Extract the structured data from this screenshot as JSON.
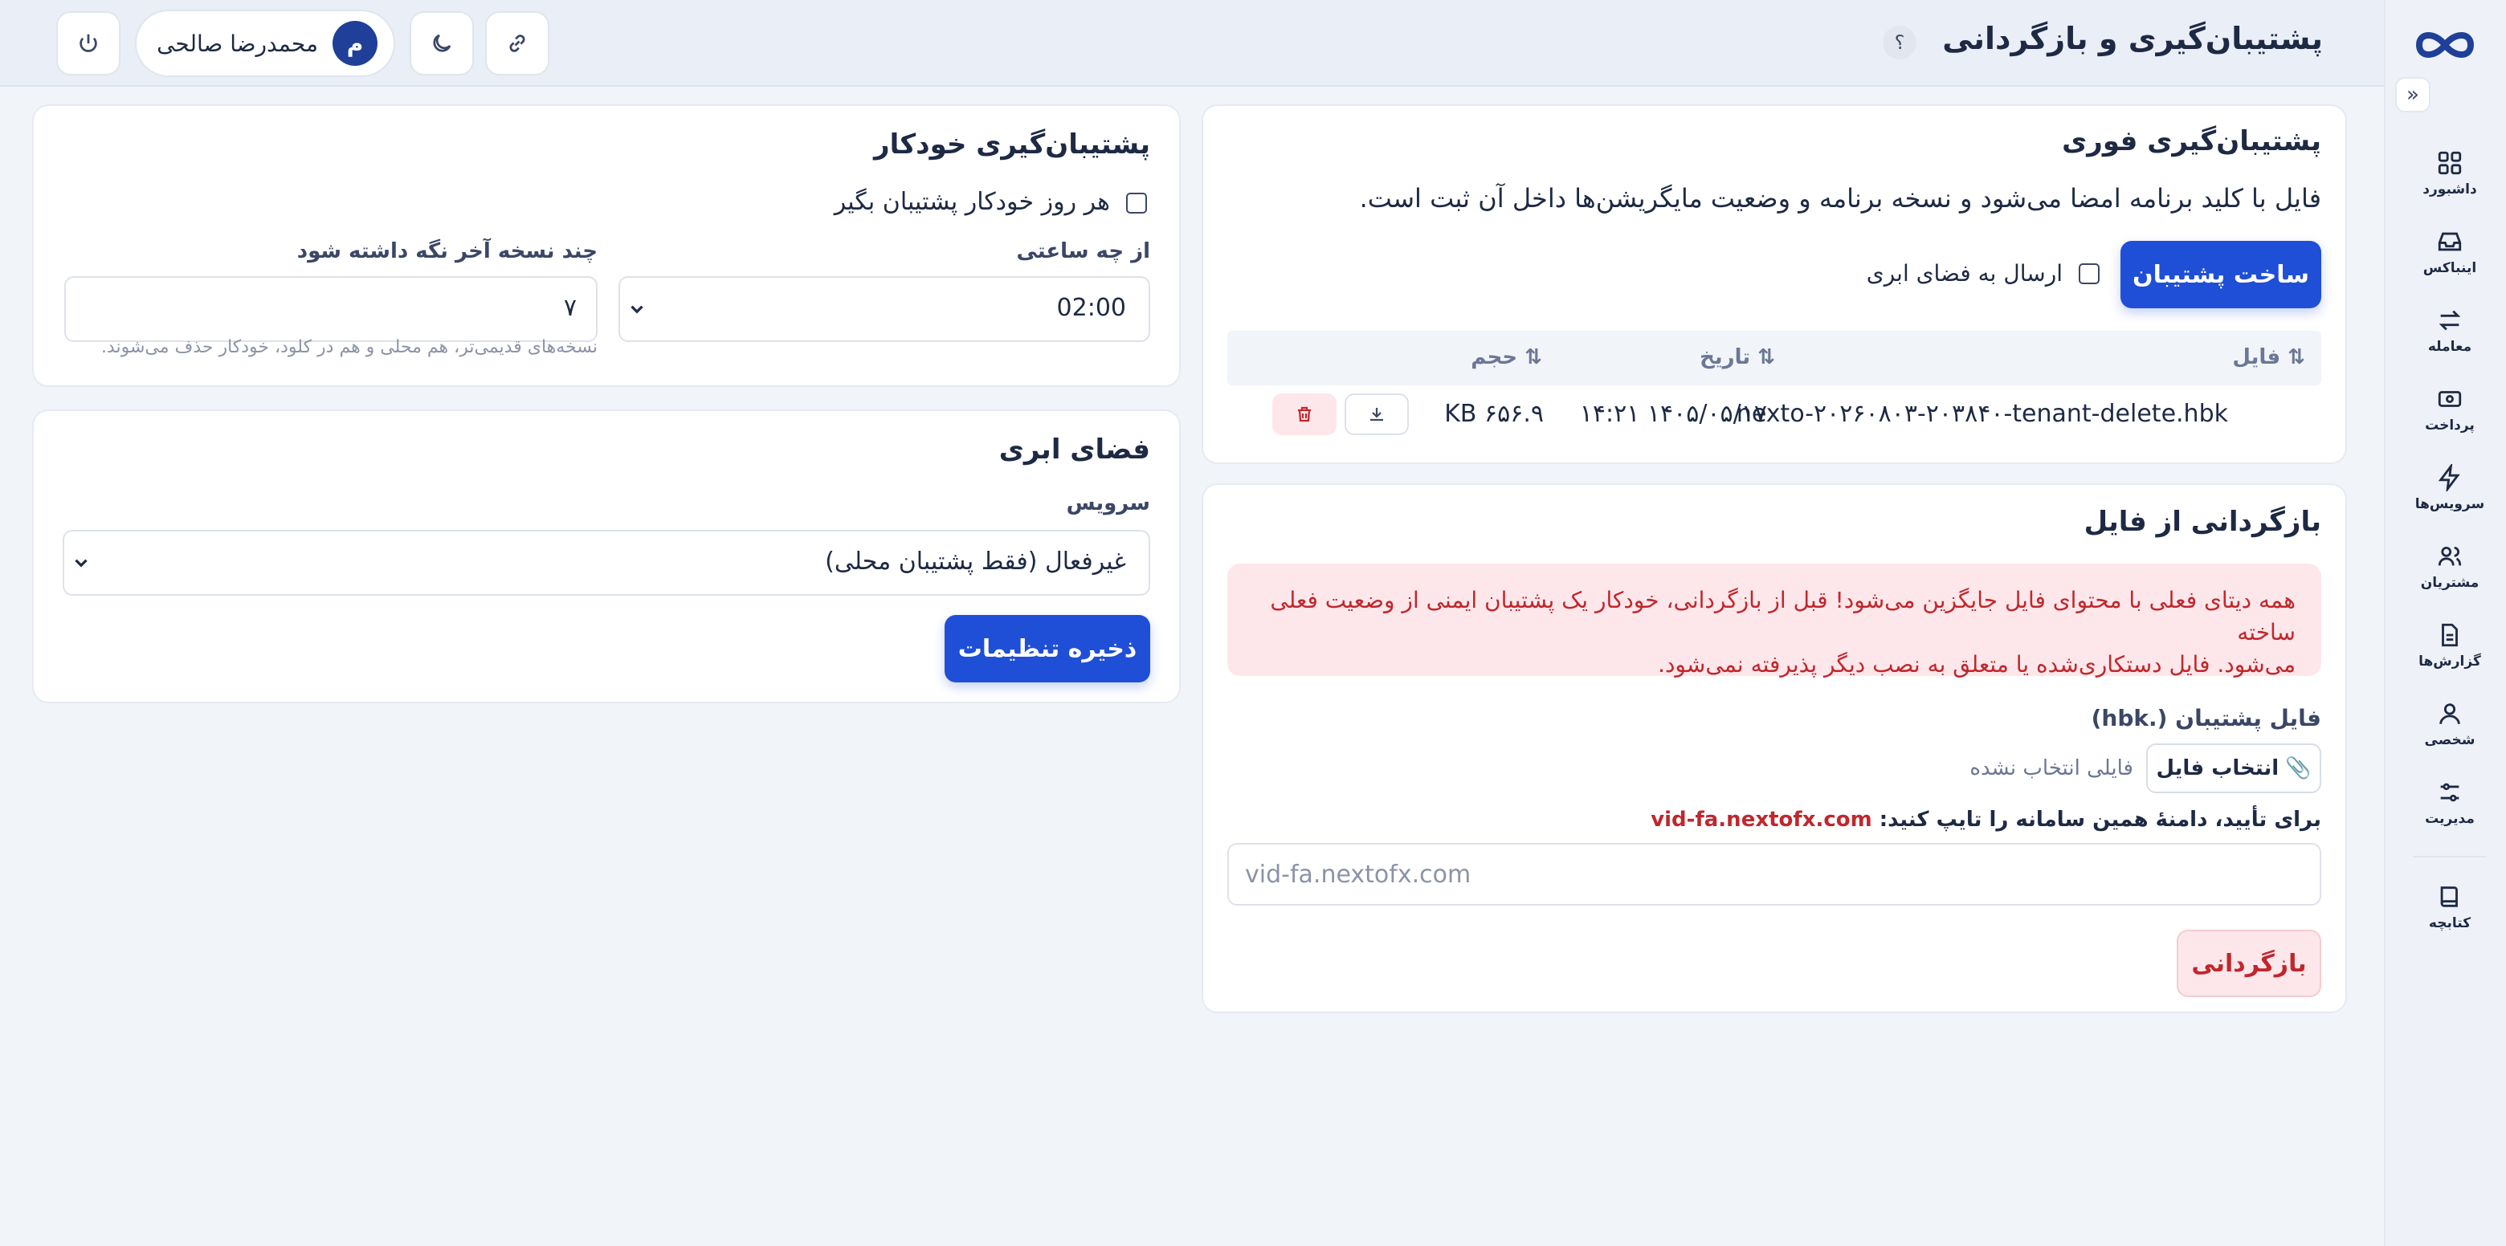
{
  "page": {
    "title": "پشتیبان‌گیری و بازگردانی",
    "help": "؟"
  },
  "sidebar": {
    "items": [
      {
        "label": "داشبورد",
        "icon": "dashboard-icon"
      },
      {
        "label": "اینباکس",
        "icon": "inbox-icon"
      },
      {
        "label": "معامله",
        "icon": "trade-icon"
      },
      {
        "label": "پرداخت",
        "icon": "payment-icon"
      },
      {
        "label": "سرویس‌ها",
        "icon": "lightning-icon"
      },
      {
        "label": "مشتریان",
        "icon": "users-icon"
      },
      {
        "label": "گزارش‌ها",
        "icon": "report-icon"
      },
      {
        "label": "شخصی",
        "icon": "user-icon"
      },
      {
        "label": "مدیریت",
        "icon": "sliders-icon"
      }
    ],
    "footer_item": {
      "label": "کتابچه",
      "icon": "book-icon"
    }
  },
  "header": {
    "user_name": "محمدرضا صالحی",
    "user_initial": "م"
  },
  "instant_backup": {
    "title": "پشتیبان‌گیری فوری",
    "description": "فایل با کلید برنامه امضا می‌شود و نسخه برنامه و وضعیت مایگریشن‌ها داخل آن ثبت است.",
    "create_button": "ساخت پشتیبان",
    "cloud_checkbox_label": "ارسال به فضای ابری",
    "table": {
      "headers": {
        "file": "⇅ فایل",
        "date": "⇅ تاریخ",
        "size": "⇅ حجم"
      },
      "rows": [
        {
          "file": "nexto-۲۰۲۶۰۸۰۳-۲۰۳۸۴۰-tenant-delete.hbk",
          "date": "۱۴۰۵/۰۵/۱۷ ۱۴:۲۱",
          "size": "۶۵۶.۹ KB"
        }
      ]
    }
  },
  "restore": {
    "title": "بازگردانی از فایل",
    "warning_line1": "همه دیتای فعلی با محتوای فایل جایگزین می‌شود! قبل از بازگردانی، خودکار یک پشتیبان ایمنی از وضعیت فعلی ساخته",
    "warning_line2": "می‌شود. فایل دستکاری‌شده یا متعلق به نصب دیگر پذیرفته نمی‌شود.",
    "file_label": "فایل پشتیبان (.hbk)",
    "choose_file": "انتخاب فایل",
    "no_file": "فایلی انتخاب نشده",
    "confirm_prompt": "برای تأیید، دامنهٔ همین سامانه را تایپ کنید:",
    "confirm_domain": "vid-fa.nextofx.com",
    "confirm_placeholder": "vid-fa.nextofx.com",
    "restore_button": "بازگردانی"
  },
  "auto_backup": {
    "title": "پشتیبان‌گیری خودکار",
    "daily_label": "هر روز خودکار پشتیبان بگیر",
    "time_label": "از چه ساعتی",
    "time_value": "02:00",
    "keep_label": "چند نسخه آخر نگه داشته شود",
    "keep_value": "۷",
    "keep_hint": "نسخه‌های قدیمی‌تر، هم محلی و هم در کلود، خودکار حذف می‌شوند."
  },
  "cloud": {
    "title": "فضای ابری",
    "service_label": "سرویس",
    "service_value": "غیرفعال (فقط پشتیبان محلی)",
    "save_button": "ذخیره تنظیمات"
  },
  "colors": {
    "primary": "#1f4fd6",
    "danger": "#c0272d",
    "danger_bg": "#fde7ea",
    "avatar": "#1f3f99"
  }
}
